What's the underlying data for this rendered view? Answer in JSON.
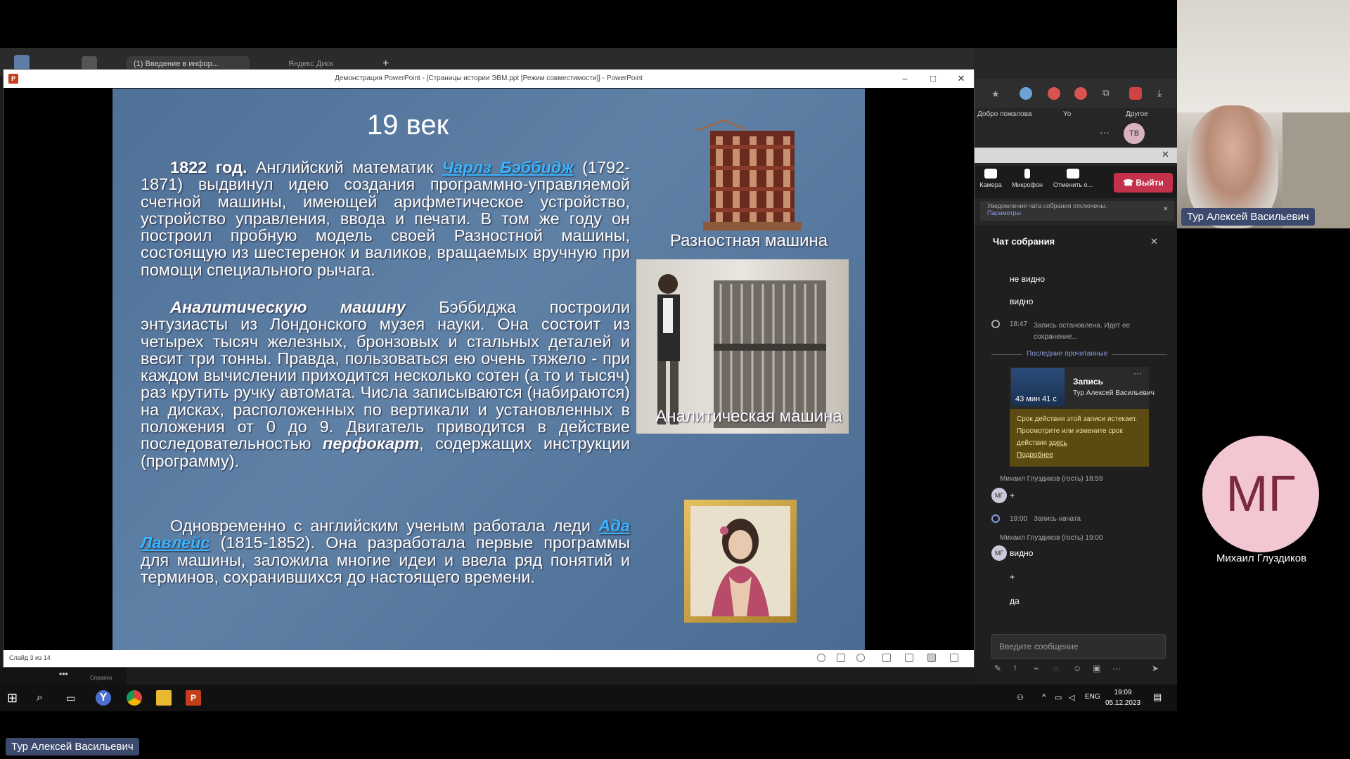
{
  "browser": {
    "active_tab": "(1) Введение в инфор...",
    "tab2": "Яндекс Диск",
    "bookmarks": [
      "Добро пожалова",
      "Yo",
      "Другое"
    ]
  },
  "ppt": {
    "window_title": "Демонстрация PowerPoint - [Страницы истории ЭВМ.ppt [Режим совместимости]] - PowerPoint",
    "status": "Слайд 3 из 14",
    "app_icon": "P"
  },
  "slide": {
    "title": "19 век",
    "p1_year": "1822 год.",
    "p1_lead": " Английский математик ",
    "p1_link": "Чарлз Бэббидж",
    "p1_rest": " (1792-1871) выдвинул идею создания программно-управляемой счетной машины, имеющей арифметическое устройство, устройство управления, ввода и печати. В том же году он построил пробную модель своей Разностной машины, состоящую из шестеренок и валиков, вращаемых вручную при помощи специального рычага.",
    "p2_lead": "Аналитическую машину",
    "p2_mid": " Бэббиджа построили энтузиасты из Лондонского музея науки. Она состоит из четырех тысяч железных, бронзовых и стальных деталей и весит три тонны. Правда, пользоваться ею очень тяжело - при каждом вычислении приходится несколько сотен (а то и тысяч) раз крутить ручку автомата. Числа записываются (набираются) на дисках, расположенных по вертикали и установленных в положения от 0 до 9. Двигатель приводится в действие последовательностью ",
    "p2_em": "перфокарт",
    "p2_end": ", содержащих инструкции (программу).",
    "p3_lead": "Одновременно с английским ученым работала леди ",
    "p3_link": "Ада Лавлейс",
    "p3_rest": " (1815-1852). Она разработала первые программы для машины, заложила многие идеи и ввела ряд понятий и терминов, сохранившихся до настоящего времени.",
    "caption1": "Разностная машина",
    "caption2": "Аналитическая машина"
  },
  "meeting": {
    "avatar_initials": "ТВ",
    "controls": [
      "Камера",
      "Микрофон",
      "Отменить о..."
    ],
    "leave": "Выйти",
    "notice": "Уведомления чата собрания отключены.",
    "notice_link": "Параметры",
    "chat_title": "Чат собрания",
    "msgs": {
      "m1": "не видно",
      "m2": "видно",
      "event1_time": "18:47",
      "event1": "Запись остановлена. Идет ее сохранение...",
      "last_read": "Последние прочитанные",
      "rec_title": "Запись",
      "rec_author": "Тур Алексей Васильевич",
      "rec_duration": "43 мин 41 с",
      "rec_note1": "Срок действия этой записи истекает. Просмотрите или измените срок действия ",
      "rec_note_link": "здесь",
      "rec_note_more": "Подробнее",
      "sender1": "Михаил Глуздиков (гость)  18:59",
      "event2_time": "19:00",
      "event2": "Запись начата",
      "sender2": "Михаил Глуздиков (гость)  19:00",
      "m3": "видно",
      "m4": "+",
      "m5": "да",
      "avatar_mg": "МГ",
      "plus1": "+"
    },
    "composer": "Введите сообщение"
  },
  "taskbar": {
    "lang": "ENG",
    "time": "19:09",
    "date": "05.12.2023",
    "help": "Справка"
  },
  "participants": {
    "main_name": "Тур Алексей Васильевич",
    "mg_initials": "МГ",
    "mg_name": "Михаил Глуздиков",
    "bottom_name": "Тур Алексей Васильевич"
  }
}
